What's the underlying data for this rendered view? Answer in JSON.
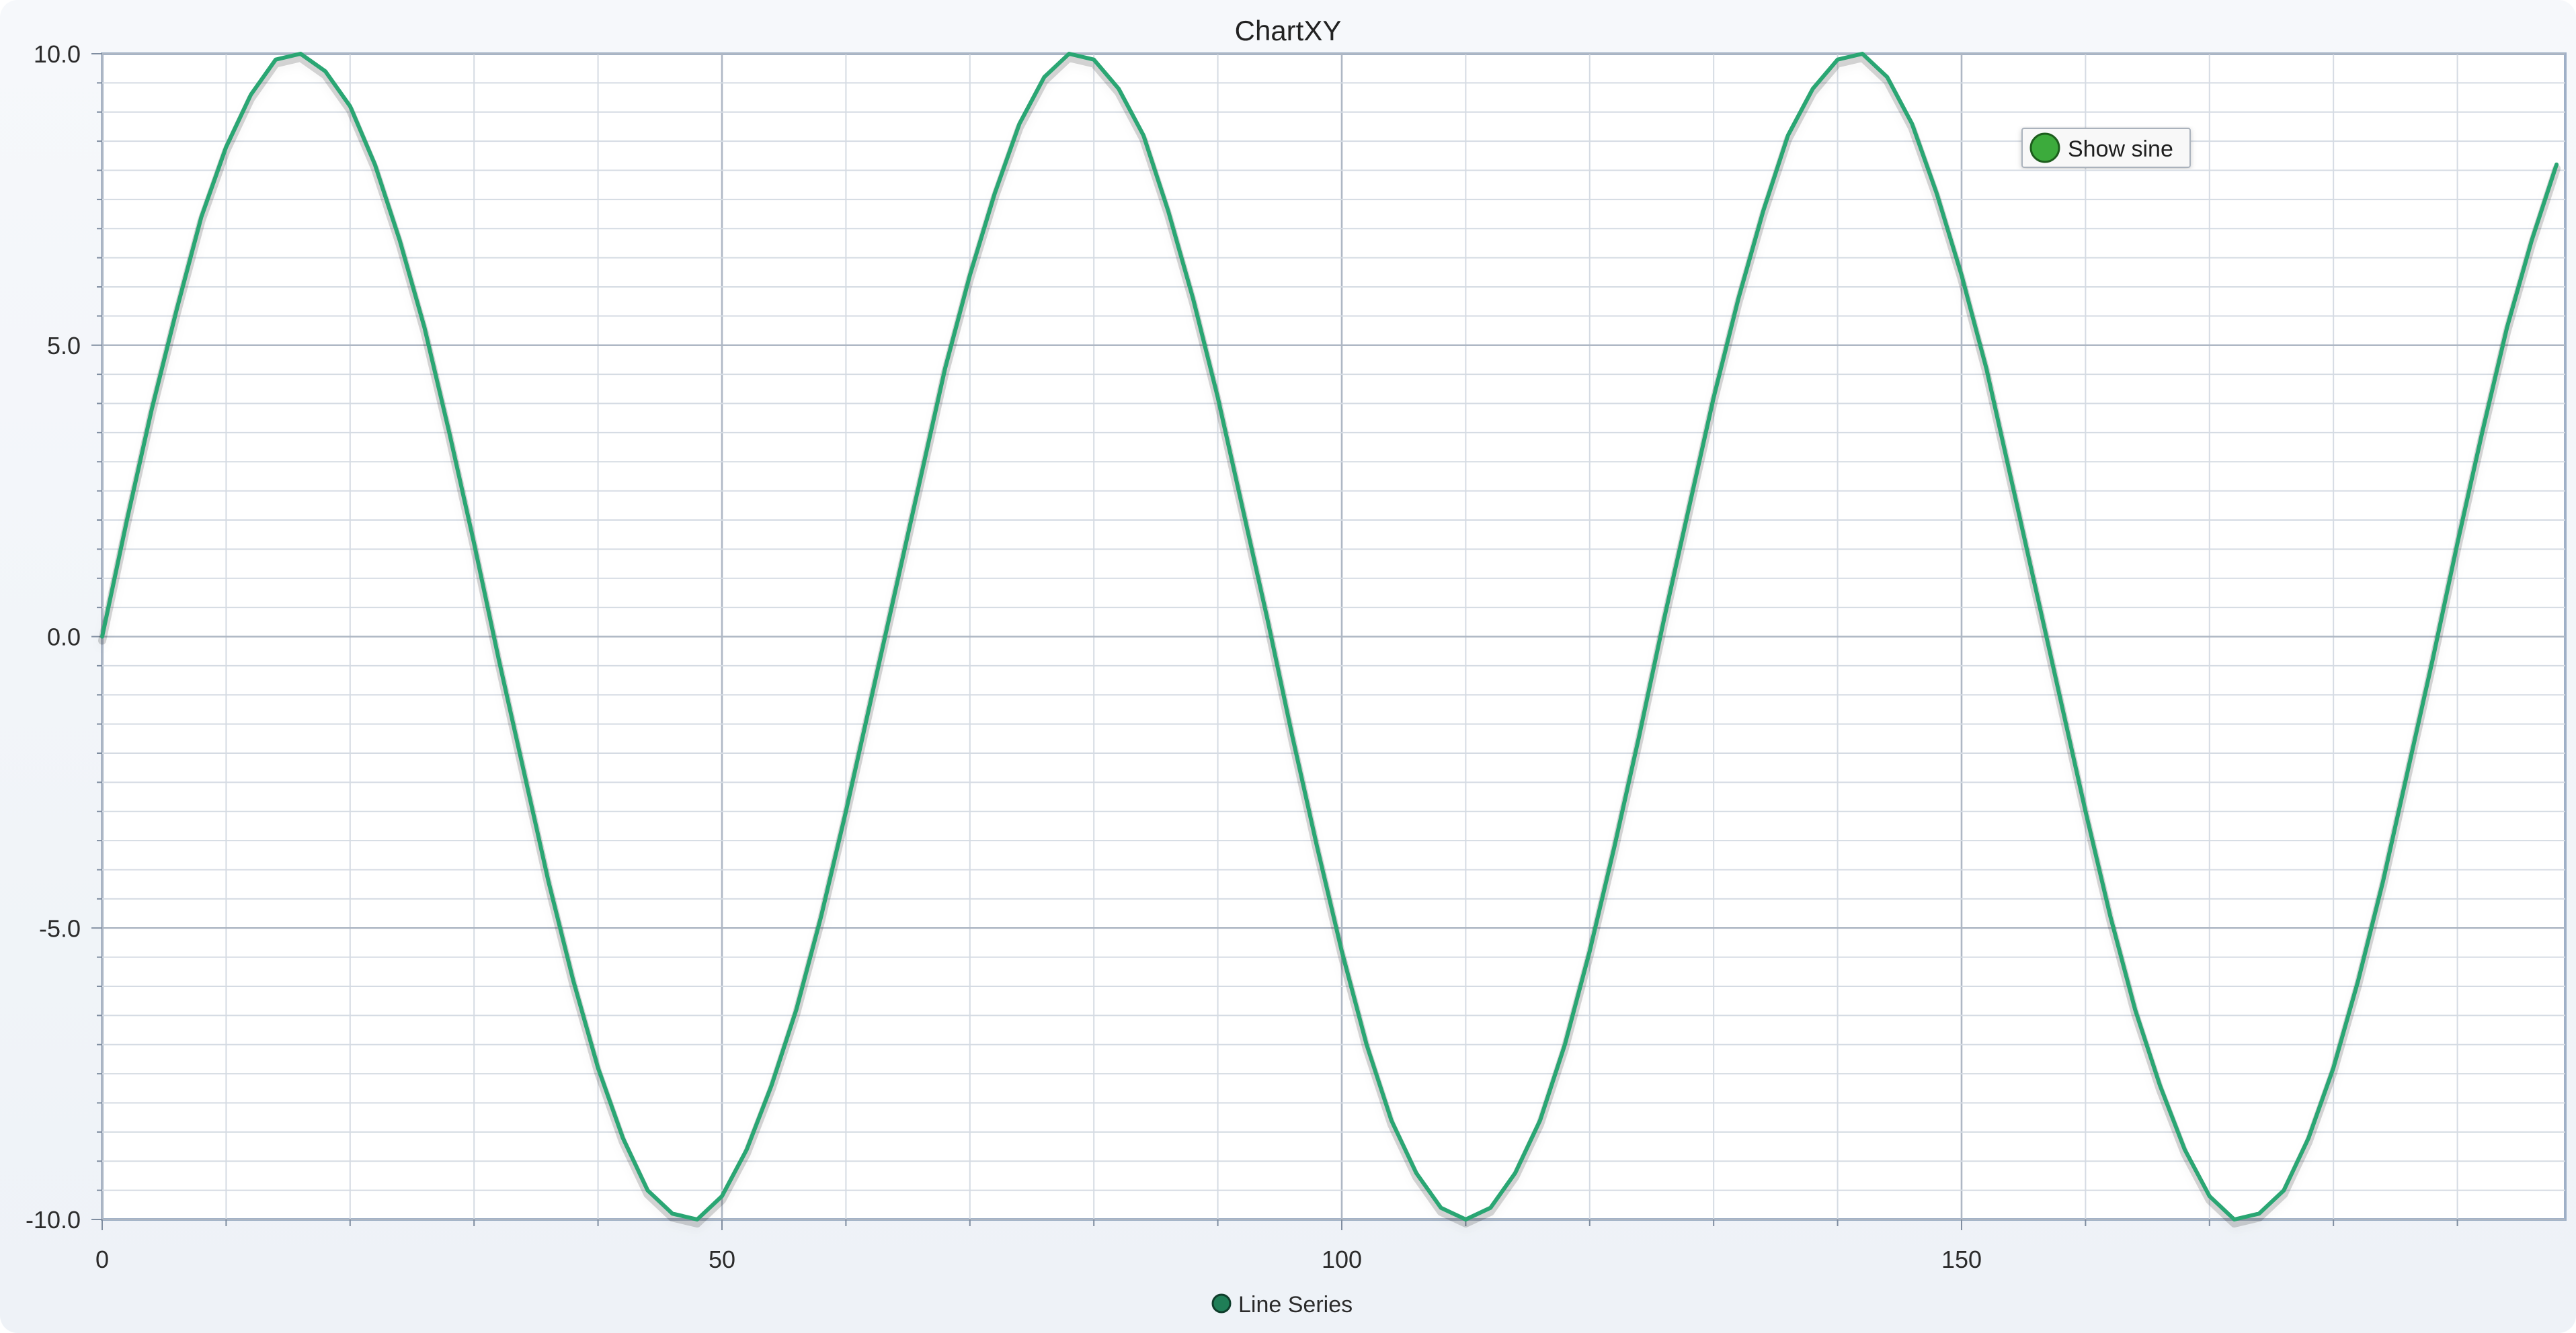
{
  "chart_data": {
    "type": "line",
    "title": "ChartXY",
    "xlabel": "",
    "ylabel": "",
    "xlim": [
      0,
      198.7
    ],
    "ylim": [
      -10,
      10
    ],
    "grid": true,
    "legend_position": "bottom-center",
    "x_tick_labels": [
      "0",
      "50",
      "100",
      "150"
    ],
    "y_tick_labels": [
      "10.0",
      "5.0",
      "0.0",
      "-5.0",
      "-10.0"
    ],
    "series": [
      {
        "name": "Line Series",
        "color": "#2aa673",
        "x": [
          0,
          2,
          4,
          6,
          8,
          10,
          12,
          14,
          16,
          18,
          20,
          22,
          24,
          26,
          28,
          30,
          32,
          34,
          36,
          38,
          40,
          42,
          44,
          46,
          48,
          50,
          52,
          54,
          56,
          58,
          60,
          62,
          64,
          66,
          68,
          70,
          72,
          74,
          76,
          78,
          80,
          82,
          84,
          86,
          88,
          90,
          92,
          94,
          96,
          98,
          100,
          102,
          104,
          106,
          108,
          110,
          112,
          114,
          116,
          118,
          120,
          122,
          124,
          126,
          128,
          130,
          132,
          134,
          136,
          138,
          140,
          142,
          144,
          146,
          148,
          150,
          152,
          154,
          156,
          158,
          160,
          162,
          164,
          166,
          168,
          170,
          172,
          174,
          176,
          178,
          180,
          182,
          184,
          186,
          188,
          190,
          192,
          194,
          196,
          198
        ],
        "y": [
          0.0,
          2.0,
          3.9,
          5.6,
          7.2,
          8.4,
          9.3,
          9.9,
          10.0,
          9.7,
          9.1,
          8.1,
          6.8,
          5.3,
          3.5,
          1.6,
          -0.4,
          -2.3,
          -4.2,
          -5.9,
          -7.4,
          -8.6,
          -9.5,
          -9.9,
          -10.0,
          -9.6,
          -8.8,
          -7.7,
          -6.4,
          -4.8,
          -3.0,
          -1.1,
          0.8,
          2.7,
          4.6,
          6.2,
          7.6,
          8.8,
          9.6,
          10.0,
          9.9,
          9.4,
          8.6,
          7.3,
          5.8,
          4.1,
          2.2,
          0.3,
          -1.7,
          -3.6,
          -5.4,
          -7.0,
          -8.3,
          -9.2,
          -9.8,
          -10.0,
          -9.8,
          -9.2,
          -8.3,
          -7.0,
          -5.4,
          -3.6,
          -1.7,
          0.3,
          2.2,
          4.1,
          5.8,
          7.3,
          8.6,
          9.4,
          9.9,
          10.0,
          9.6,
          8.8,
          7.6,
          6.2,
          4.6,
          2.7,
          0.8,
          -1.1,
          -3.0,
          -4.8,
          -6.4,
          -7.7,
          -8.8,
          -9.6,
          -10.0,
          -9.9,
          -9.5,
          -8.6,
          -7.4,
          -5.9,
          -4.2,
          -2.3,
          -0.4,
          1.6,
          3.5,
          5.3,
          6.8,
          8.1
        ]
      }
    ],
    "annotation": {
      "label": "Show sine",
      "indicator_color": "#3cab3c"
    }
  }
}
